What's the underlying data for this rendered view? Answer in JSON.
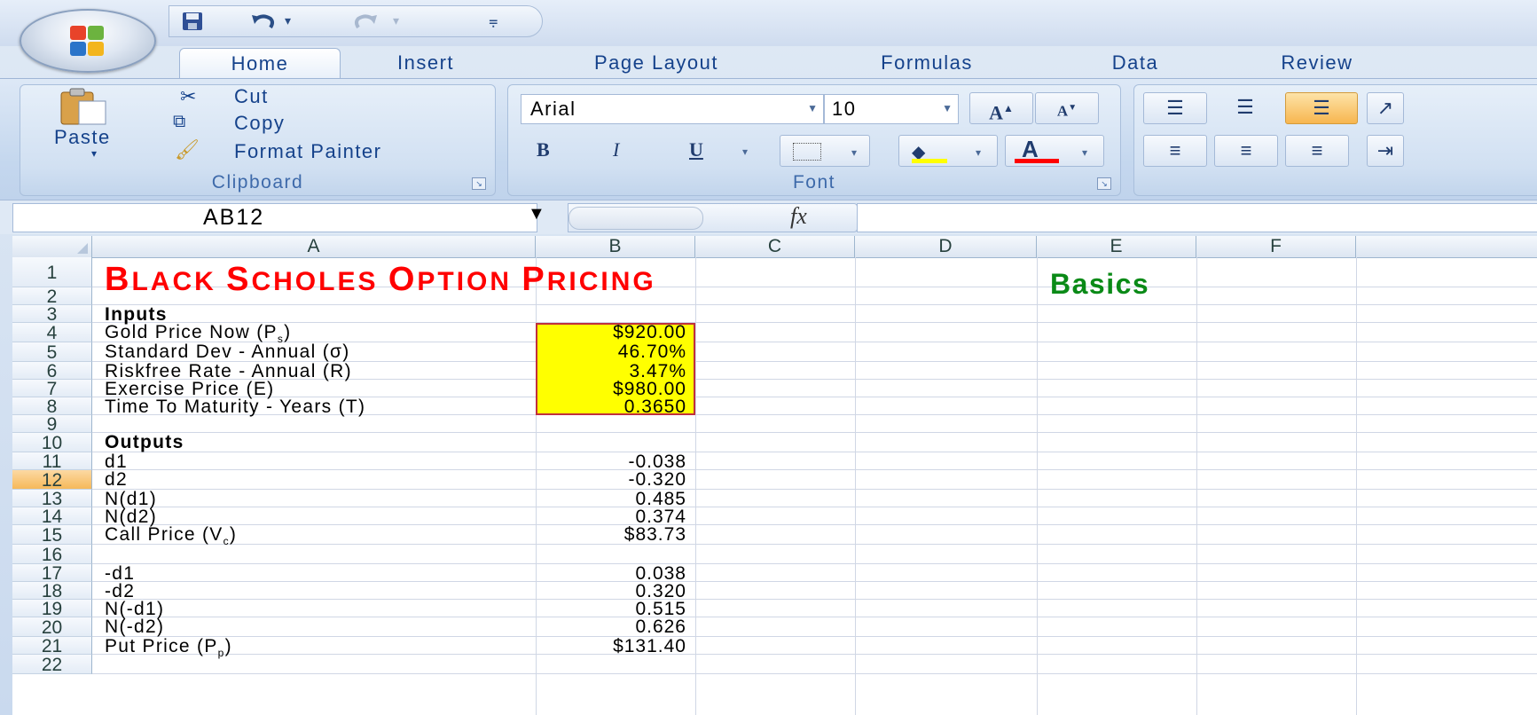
{
  "quick_access": {
    "save_icon": "save-icon",
    "undo_icon": "undo-icon",
    "redo_icon": "redo-icon"
  },
  "tabs": [
    "Home",
    "Insert",
    "Page Layout",
    "Formulas",
    "Data",
    "Review"
  ],
  "clipboard": {
    "paste": "Paste",
    "cut": "Cut",
    "copy": "Copy",
    "format_painter": "Format Painter",
    "label": "Clipboard"
  },
  "font": {
    "name": "Arial",
    "size": "10",
    "label": "Font",
    "bold": "B",
    "italic": "I",
    "underline": "U"
  },
  "formula_bar": {
    "name_box": "AB12",
    "fx": "fx",
    "content": ""
  },
  "columns": [
    "A",
    "B",
    "C",
    "D",
    "E",
    "F"
  ],
  "rows": [
    "1",
    "2",
    "3",
    "4",
    "5",
    "6",
    "7",
    "8",
    "9",
    "10",
    "11",
    "12",
    "13",
    "14",
    "15",
    "16",
    "17",
    "18",
    "19",
    "20",
    "21",
    "22"
  ],
  "selected_row": "12",
  "sheet": {
    "title_parts": [
      "B",
      "LACK ",
      "S",
      "CHOLES ",
      "O",
      "PTION ",
      "P",
      "RICING"
    ],
    "basics": "Basics",
    "inputs_header": "Inputs",
    "outputs_header": "Outputs",
    "inputs": [
      {
        "label": "Gold Price Now (P",
        "sub": "s",
        "tail": ")",
        "value": "$920.00"
      },
      {
        "label": "Standard Dev - Annual (σ)",
        "sub": "",
        "tail": "",
        "value": "46.70%"
      },
      {
        "label": "Riskfree Rate - Annual (R)",
        "sub": "",
        "tail": "",
        "value": "3.47%"
      },
      {
        "label": "Exercise Price (E)",
        "sub": "",
        "tail": "",
        "value": "$980.00"
      },
      {
        "label": "Time To Maturity - Years (T)",
        "sub": "",
        "tail": "",
        "value": "0.3650"
      }
    ],
    "outputs": [
      {
        "label": "d1",
        "sub": "",
        "tail": "",
        "value": "-0.038"
      },
      {
        "label": "d2",
        "sub": "",
        "tail": "",
        "value": "-0.320"
      },
      {
        "label": "N(d1)",
        "sub": "",
        "tail": "",
        "value": "0.485"
      },
      {
        "label": "N(d2)",
        "sub": "",
        "tail": "",
        "value": "0.374"
      },
      {
        "label": "Call Price (V",
        "sub": "c",
        "tail": ")",
        "value": "$83.73"
      }
    ],
    "outputs2": [
      {
        "label": "-d1",
        "sub": "",
        "tail": "",
        "value": "0.038"
      },
      {
        "label": "-d2",
        "sub": "",
        "tail": "",
        "value": "0.320"
      },
      {
        "label": "N(-d1)",
        "sub": "",
        "tail": "",
        "value": "0.515"
      },
      {
        "label": "N(-d2)",
        "sub": "",
        "tail": "",
        "value": "0.626"
      },
      {
        "label": "Put  Price (P",
        "sub": "p",
        "tail": ")",
        "value": "$131.40"
      }
    ]
  },
  "colors": {
    "title": "#ff0000",
    "basics": "#0a8a17",
    "input_fill": "#ffff00",
    "input_border": "#c0303c"
  }
}
